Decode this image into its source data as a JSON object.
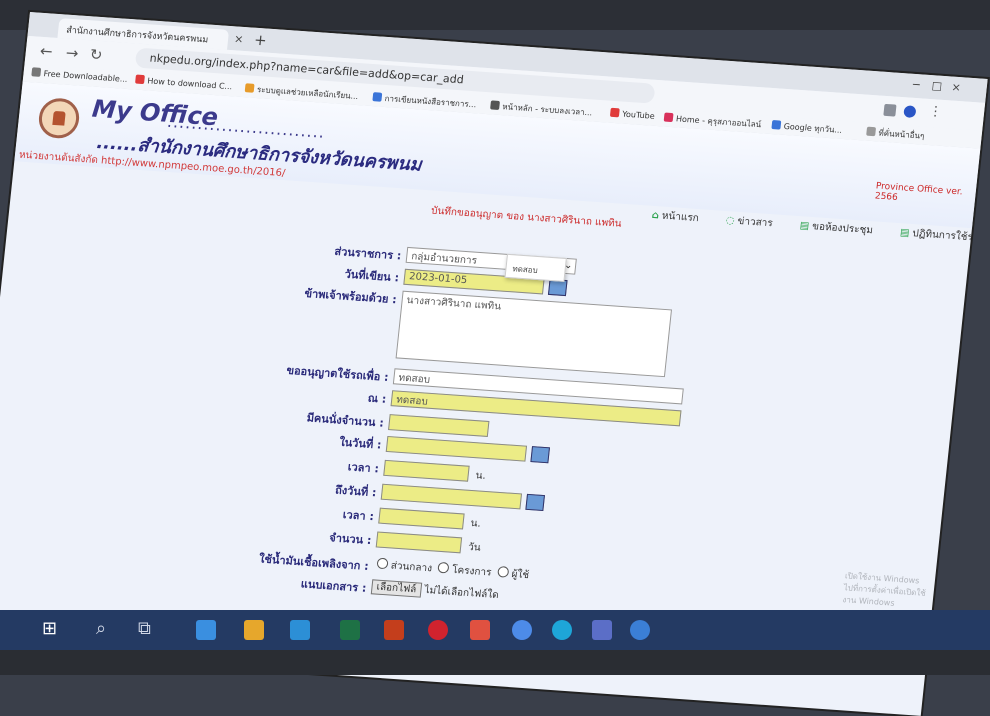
{
  "browser": {
    "tab_title": "สำนักงานศึกษาธิการจังหวัดนครพนม",
    "tab_close": "×",
    "new_tab": "+",
    "url": "nkpedu.org/index.php?name=car&file=add&op=car_add",
    "bookmarks": [
      "Free Downloadable...",
      "How to download C...",
      "ระบบดูแลช่วยเหลือนักเรียน...",
      "การเขียนหนังสือราชการ...",
      "หน้าหลัก - ระบบลงเวลา...",
      "YouTube",
      "Home - คุรุสภาออนไลน์",
      "Google ทุกวัน...",
      "ที่คั่นหน้าอื่นๆ"
    ]
  },
  "site": {
    "brand": "My Office",
    "dots": "..........................",
    "office_name": "......สำนักงานศึกษาธิการจังหวัดนครพนม",
    "url_line": "หน่วยงานต้นสังกัด http://www.npmpeo.moe.go.th/2016/",
    "mini_nav": "Province Office ver. 2566"
  },
  "nav": {
    "home": "หน้าแรก",
    "news": "ข่าวสาร",
    "meeting": "ขอห้องประชุม",
    "profile": "ปฏิทินการใช้รถยนต์"
  },
  "notice": "บันทึกขออนุญาต ของ นางสาวศิรินาถ แพทิน",
  "form": {
    "dept_label": "ส่วนราชการ :",
    "dept_value": "กลุ่มอำนวยการ",
    "date_label": "วันที่เขียน :",
    "date_value": "2023-01-05",
    "with_label": "ข้าพเจ้าพร้อมด้วย :",
    "with_value": "นางสาวศิรินาถ แพทิน",
    "purpose_label": "ขออนุญาตใช้รถเพื่อ :",
    "purpose_value": "ทดสอบ",
    "place_label": "ณ :",
    "place_value": "ทดสอบ",
    "people_label": "มีคนนั่งจำนวน :",
    "suggestion": "ทดสอบ",
    "start_date_label": "ในวันที่ :",
    "start_time_label": "เวลา :",
    "end_date_label": "ถึงวันที่ :",
    "end_time_label": "เวลา :",
    "hour_unit": "น.",
    "days_label": "จำนวน :",
    "days_unit": "วัน",
    "fuel_label": "ใช้น้ำมันเชื้อเพลิงจาก :",
    "fuel_options": [
      "ส่วนกลาง",
      "โครงการ",
      "ผู้ใช้"
    ],
    "attach_label": "แนบเอกสาร :",
    "file_button": "เลือกไฟล์",
    "file_status": "ไม่ได้เลือกไฟล์ใด"
  },
  "watermark": {
    "line1": "เปิดใช้งาน Windows",
    "line2": "ไปที่การตั้งค่าเพื่อเปิดใช้งาน Windows"
  }
}
